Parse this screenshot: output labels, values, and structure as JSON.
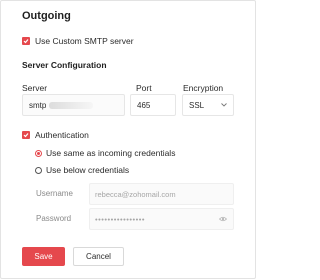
{
  "title": "Outgoing",
  "use_custom_smtp": {
    "label": "Use Custom SMTP server",
    "checked": true
  },
  "server_config": {
    "heading": "Server Configuration",
    "columns": {
      "server": "Server",
      "port": "Port",
      "encryption": "Encryption"
    },
    "server_value": "smtp",
    "port_value": "465",
    "encryption_value": "SSL",
    "encryption_icon": "chevron-down-icon"
  },
  "authentication": {
    "label": "Authentication",
    "checked": true,
    "options": [
      {
        "label": "Use same as incoming credentials",
        "selected": true
      },
      {
        "label": "Use below credentials",
        "selected": false
      }
    ],
    "username": {
      "label": "Username",
      "placeholder": "rebecca@zohomail.com"
    },
    "password": {
      "label": "Password",
      "placeholder": "••••••••••••••••",
      "icon": "eye-icon"
    }
  },
  "actions": {
    "save_label": "Save",
    "cancel_label": "Cancel"
  },
  "colors": {
    "accent": "#e5484d",
    "border": "#e3e3e3",
    "muted": "#a6a6a6"
  }
}
